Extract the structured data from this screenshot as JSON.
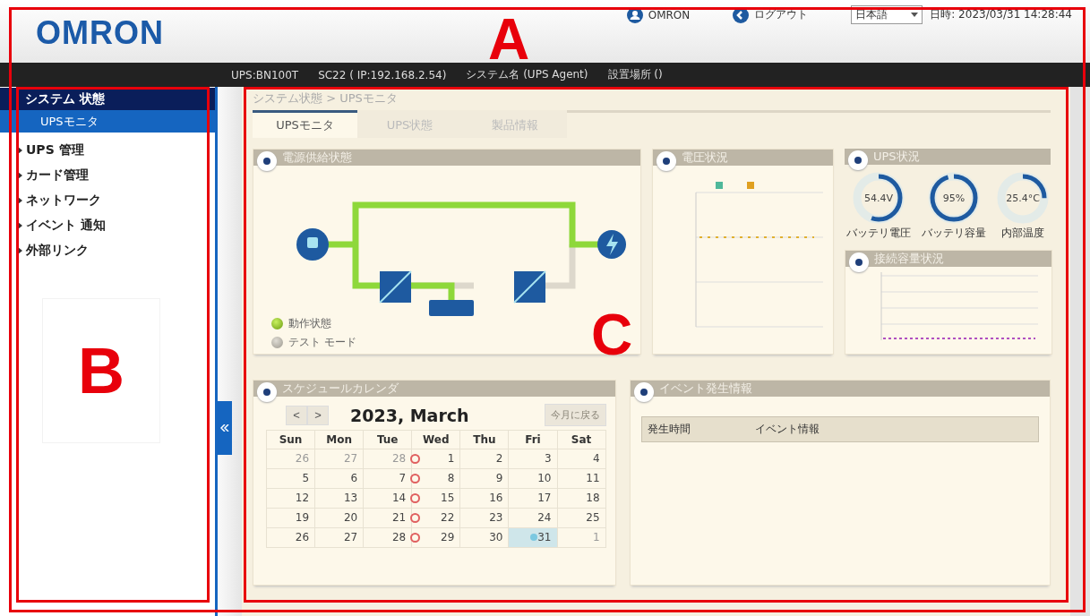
{
  "header": {
    "logo": "OMRON",
    "user": "OMRON",
    "logout": "ログアウト",
    "language": "日本語",
    "datetime": "日時: 2023/03/31 14:28:44"
  },
  "info_bar": [
    "UPS:BN100T",
    "SC22 ( IP:192.168.2.54)",
    "システム名 (UPS Agent)",
    "設置場所 ()"
  ],
  "sidebar": {
    "items": [
      {
        "label": "システム 状態",
        "expanded": true,
        "selected": true,
        "children": [
          {
            "label": "UPSモニタ",
            "selected": true
          }
        ]
      },
      {
        "label": "UPS 管理",
        "expanded": false,
        "selected": false
      },
      {
        "label": "カード管理",
        "expanded": false,
        "selected": false
      },
      {
        "label": "ネットワーク",
        "expanded": false,
        "selected": false
      },
      {
        "label": "イベント 通知",
        "expanded": false,
        "selected": false
      },
      {
        "label": "外部リンク",
        "expanded": false,
        "selected": false
      }
    ]
  },
  "breadcrumb": "システム状態 > UPSモニタ",
  "tabs": [
    {
      "label": "UPSモニタ",
      "selected": true
    },
    {
      "label": "UPS状態",
      "selected": false
    },
    {
      "label": "製品情報",
      "selected": false
    }
  ],
  "power_panel": {
    "title": "電源供給状態",
    "legend": [
      {
        "label": "動作状態",
        "on": true
      },
      {
        "label": "テスト モード",
        "on": false
      }
    ]
  },
  "voltage_panel": {
    "title": "電圧状況"
  },
  "ups_status": {
    "title": "UPS状況",
    "gauges": [
      {
        "reading": "54.4V",
        "label": "バッテリ電圧",
        "level": 0.55
      },
      {
        "reading": "95%",
        "label": "バッテリ容量",
        "level": 0.95
      },
      {
        "reading": "25.4°C",
        "label": "内部温度",
        "level": 0.25
      }
    ]
  },
  "capacity_panel": {
    "title": "接続容量状況"
  },
  "calendar": {
    "title": "スケジュールカレンダ",
    "prev": "<",
    "next": ">",
    "month": "2023, March",
    "today_button": "今月に戻る",
    "weekdays": [
      "Sun",
      "Mon",
      "Tue",
      "Wed",
      "Thu",
      "Fri",
      "Sat"
    ],
    "weeks": [
      [
        {
          "day": "26",
          "muted": true
        },
        {
          "day": "27",
          "muted": true
        },
        {
          "day": "28",
          "muted": true
        },
        {
          "day": "1",
          "event": true
        },
        {
          "day": "2"
        },
        {
          "day": "3"
        },
        {
          "day": "4"
        }
      ],
      [
        {
          "day": "5"
        },
        {
          "day": "6"
        },
        {
          "day": "7"
        },
        {
          "day": "8",
          "event": true
        },
        {
          "day": "9"
        },
        {
          "day": "10"
        },
        {
          "day": "11"
        }
      ],
      [
        {
          "day": "12"
        },
        {
          "day": "13"
        },
        {
          "day": "14"
        },
        {
          "day": "15",
          "event": true
        },
        {
          "day": "16"
        },
        {
          "day": "17"
        },
        {
          "day": "18"
        }
      ],
      [
        {
          "day": "19"
        },
        {
          "day": "20"
        },
        {
          "day": "21"
        },
        {
          "day": "22",
          "event": true
        },
        {
          "day": "23"
        },
        {
          "day": "24"
        },
        {
          "day": "25"
        }
      ],
      [
        {
          "day": "26"
        },
        {
          "day": "27"
        },
        {
          "day": "28"
        },
        {
          "day": "29",
          "event": true
        },
        {
          "day": "30"
        },
        {
          "day": "31",
          "selected": true
        },
        {
          "day": "1",
          "muted": true
        }
      ]
    ]
  },
  "events": {
    "title": "イベント発生情報",
    "columns": [
      "発生時間",
      "イベント情報"
    ]
  },
  "annotations": [
    {
      "label": "A"
    },
    {
      "label": "B"
    },
    {
      "label": "C"
    }
  ]
}
